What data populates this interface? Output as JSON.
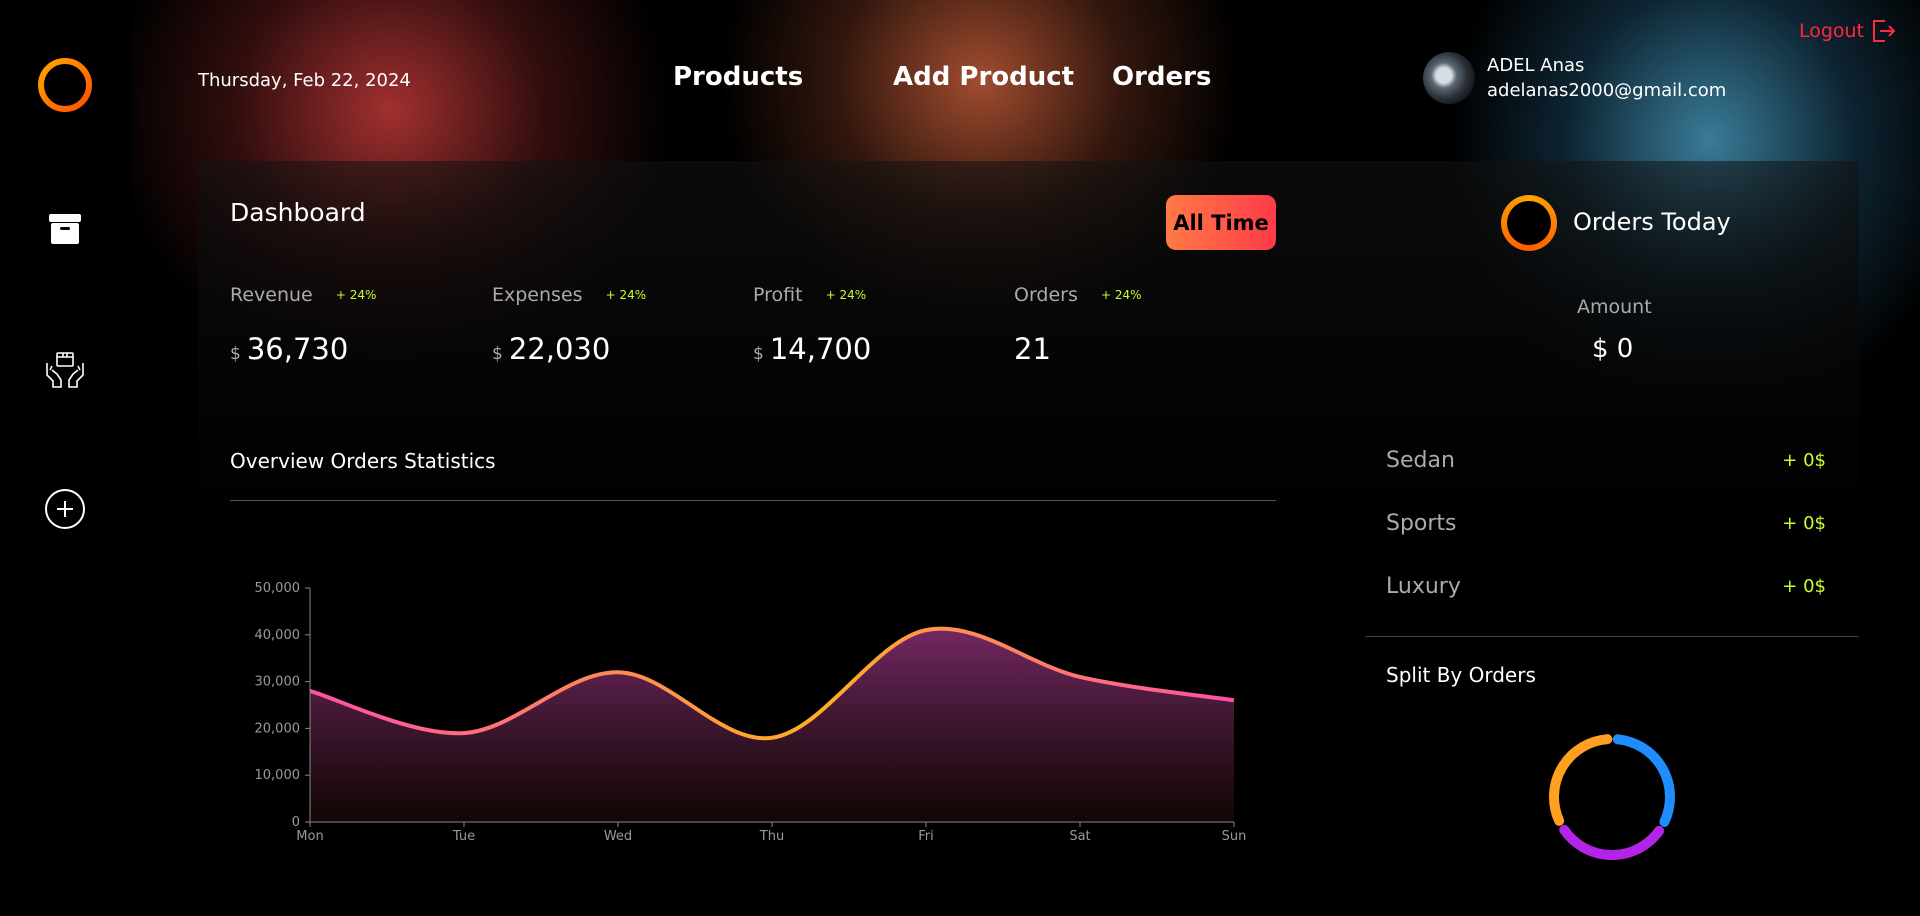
{
  "header": {
    "date": "Thursday, Feb 22, 2024",
    "nav": [
      "Products",
      "Add Product",
      "Orders"
    ],
    "logout": "Logout",
    "user": {
      "name": "ADEL Anas",
      "email": "adelanas2000@gmail.com"
    }
  },
  "sidebar": {
    "items": [
      {
        "icon": "logo-ring-icon"
      },
      {
        "icon": "archive-box-icon"
      },
      {
        "icon": "hands-with-box-icon"
      },
      {
        "icon": "add-circle-icon"
      }
    ]
  },
  "dashboard": {
    "title": "Dashboard",
    "filter": "All Time",
    "stats": [
      {
        "label": "Revenue",
        "change": "+ 24%",
        "currency": "$",
        "value": "36,730"
      },
      {
        "label": "Expenses",
        "change": "+ 24%",
        "currency": "$",
        "value": "22,030"
      },
      {
        "label": "Profit",
        "change": "+ 24%",
        "currency": "$",
        "value": "14,700"
      },
      {
        "label": "Orders",
        "change": "+ 24%",
        "currency": "",
        "value": "21"
      }
    ]
  },
  "overview": {
    "title": "Overview Orders Statistics"
  },
  "chart_data": {
    "type": "area",
    "categories": [
      "Mon",
      "Tue",
      "Wed",
      "Thu",
      "Fri",
      "Sat",
      "Sun"
    ],
    "values": [
      28000,
      19000,
      32000,
      18000,
      41000,
      31000,
      26000
    ],
    "ylim": [
      0,
      50000
    ],
    "yticks": [
      0,
      10000,
      20000,
      30000,
      40000,
      50000
    ],
    "ytick_labels": [
      "0",
      "10,000",
      "20,000",
      "30,000",
      "40,000",
      "50,000"
    ],
    "line_gradient": [
      "#ff4fa8",
      "#ffb020"
    ],
    "fill_color": "#7a2a6a"
  },
  "orders_today": {
    "title": "Orders Today",
    "amount_label": "Amount",
    "amount_value": "$ 0",
    "categories": [
      {
        "name": "Sedan",
        "value": "+ 0$"
      },
      {
        "name": "Sports",
        "value": "+ 0$"
      },
      {
        "name": "Luxury",
        "value": "+ 0$"
      }
    ]
  },
  "split": {
    "title": "Split By Orders",
    "segments": [
      {
        "color": "#1f8cff",
        "share": 0.3333
      },
      {
        "color": "#b323e8",
        "share": 0.3333
      },
      {
        "color": "#ffa020",
        "share": 0.3334
      }
    ]
  }
}
